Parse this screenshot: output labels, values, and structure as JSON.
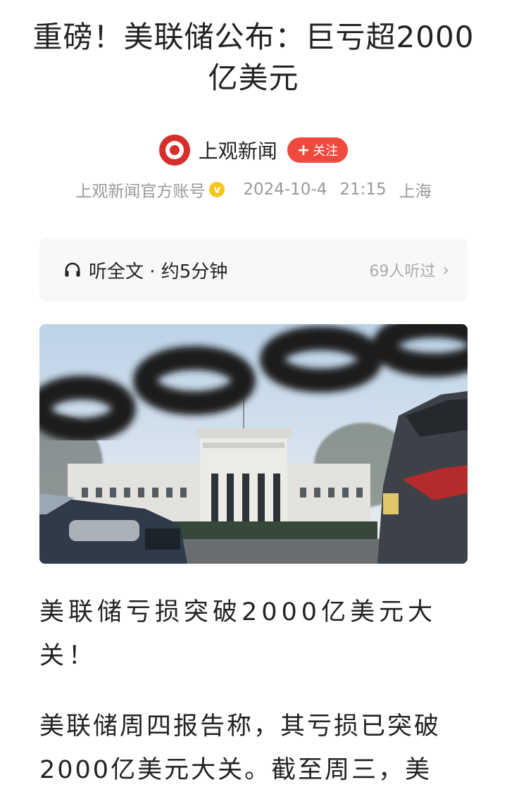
{
  "article": {
    "title": "重磅！美联储公布：巨亏超2000亿美元"
  },
  "author": {
    "name": "上观新闻",
    "follow_label": "关注",
    "follow_plus": "+"
  },
  "meta": {
    "account": "上观新闻官方账号",
    "verified_badge": "v",
    "date": "2024-10-4",
    "time": "21:15",
    "location": "上海"
  },
  "listen": {
    "label": "听全文 · 约5分钟",
    "count": "69人听过",
    "icon": "headphones-icon",
    "chevron_icon": "chevron-right-icon"
  },
  "body": {
    "p1": "美联储亏损突破2000亿美元大关！",
    "p2": "美联储周四报告称，其亏损已突破2000亿美元大关。截至周三，美"
  },
  "colors": {
    "brand_red": "#d62e2b",
    "follow_red": "#f04a3e",
    "verified_gold": "#f5c518",
    "muted_text": "#999999"
  }
}
